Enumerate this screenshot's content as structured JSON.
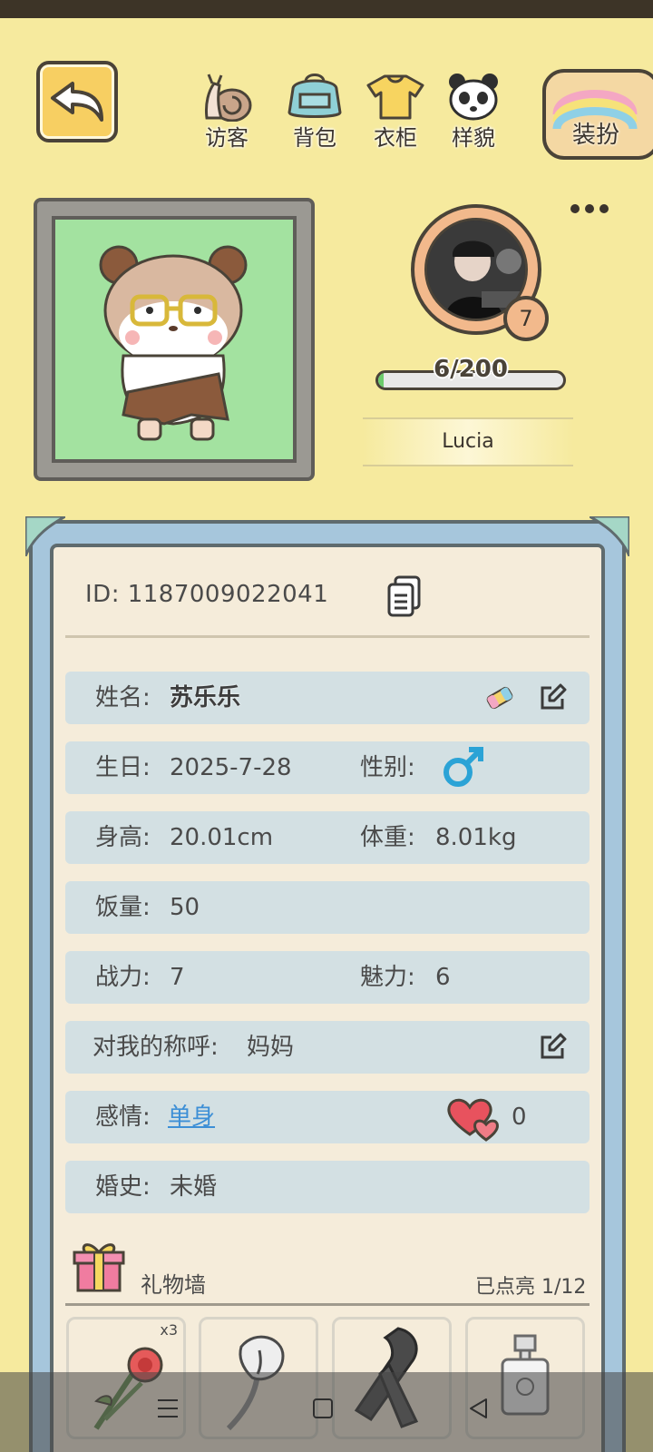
{
  "header": {
    "back_icon": "back-arrow-icon",
    "nav": [
      {
        "label": "访客",
        "icon": "snail-icon"
      },
      {
        "label": "背包",
        "icon": "backpack-icon"
      },
      {
        "label": "衣柜",
        "icon": "shirt-icon"
      },
      {
        "label": "样貌",
        "icon": "panda-face-icon"
      }
    ],
    "dress_up_label": "装扮"
  },
  "profile": {
    "level": "7",
    "exp_text": "6/200",
    "exp_fraction": 0.03,
    "nickname": "Lucia"
  },
  "card": {
    "id_label": "ID:",
    "id_value": "1187009022041",
    "name_label": "姓名:",
    "name_value": "苏乐乐",
    "birthday_label": "生日:",
    "birthday_value": "2025-7-28",
    "gender_label": "性别:",
    "height_label": "身高:",
    "height_value": "20.01cm",
    "weight_label": "体重:",
    "weight_value": "8.01kg",
    "appetite_label": "饭量:",
    "appetite_value": "50",
    "power_label": "战力:",
    "power_value": "7",
    "charm_label": "魅力:",
    "charm_value": "6",
    "title_label": "对我的称呼:",
    "title_value": "妈妈",
    "relation_label": "感情:",
    "relation_value": "单身",
    "hearts_value": "0",
    "marriage_label": "婚史:",
    "marriage_value": "未婚"
  },
  "gifts": {
    "title": "礼物墙",
    "lit_label": "已点亮",
    "lit_count": "1/12",
    "items": [
      {
        "icon": "rose-bouquet-icon",
        "qty": "x3"
      },
      {
        "icon": "calla-lily-icon"
      },
      {
        "icon": "scarf-icon"
      },
      {
        "icon": "perfume-icon"
      }
    ]
  },
  "colors": {
    "background": "#f6ea9e",
    "accent_yellow": "#f7cf62",
    "card_blue": "#a6c6dc",
    "row_bg": "#d3e0e3",
    "link": "#3d8fd6",
    "male": "#2ba3d6"
  }
}
